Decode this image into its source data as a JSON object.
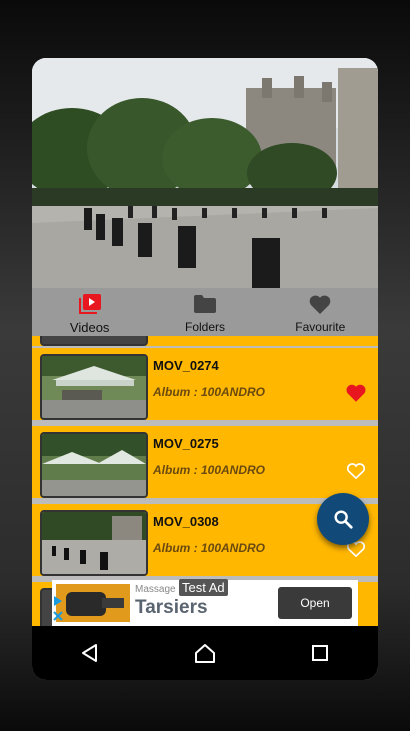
{
  "tabs": [
    {
      "label": "Videos",
      "icon": "video-library-icon",
      "active": true
    },
    {
      "label": "Folders",
      "icon": "folder-icon",
      "active": false
    },
    {
      "label": "Favourite",
      "icon": "heart-icon",
      "active": false
    }
  ],
  "videos": [
    {
      "title": "MOV_0274",
      "album": "Album : 100ANDRO",
      "favourite": true
    },
    {
      "title": "MOV_0275",
      "album": "Album : 100ANDRO",
      "favourite": false
    },
    {
      "title": "MOV_0308",
      "album": "Album : 100ANDRO",
      "favourite": false
    }
  ],
  "ad": {
    "badge": "Test Ad",
    "advertiser": "Massage C",
    "title": "Tarsiers",
    "cta": "Open"
  },
  "colors": {
    "row_bg": "#ffb700",
    "tab_bar": "#9a9a9a",
    "fab": "#114a78",
    "accent_red": "#e8161f",
    "favourite_red": "#e8161f"
  },
  "nav": {
    "back_icon": "back-triangle-icon",
    "home_icon": "home-circle-icon",
    "recents_icon": "recents-square-icon"
  }
}
